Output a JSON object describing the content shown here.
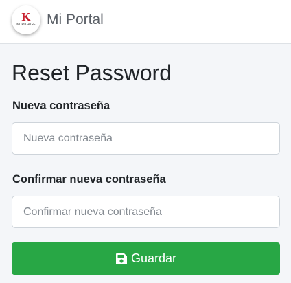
{
  "header": {
    "logo": {
      "letter": "K",
      "brand": "KURIGAGE",
      "tagline": "",
      "accent_color": "#c8202f"
    },
    "title": "Mi Portal"
  },
  "main": {
    "heading": "Reset Password",
    "fields": [
      {
        "label": "Nueva contraseña",
        "placeholder": "Nueva contraseña",
        "value": ""
      },
      {
        "label": "Confirmar nueva contraseña",
        "placeholder": "Confirmar nueva contraseña",
        "value": ""
      }
    ],
    "submit": {
      "label": "Guardar",
      "icon": "floppy-disk-icon",
      "color": "#28a745"
    }
  }
}
